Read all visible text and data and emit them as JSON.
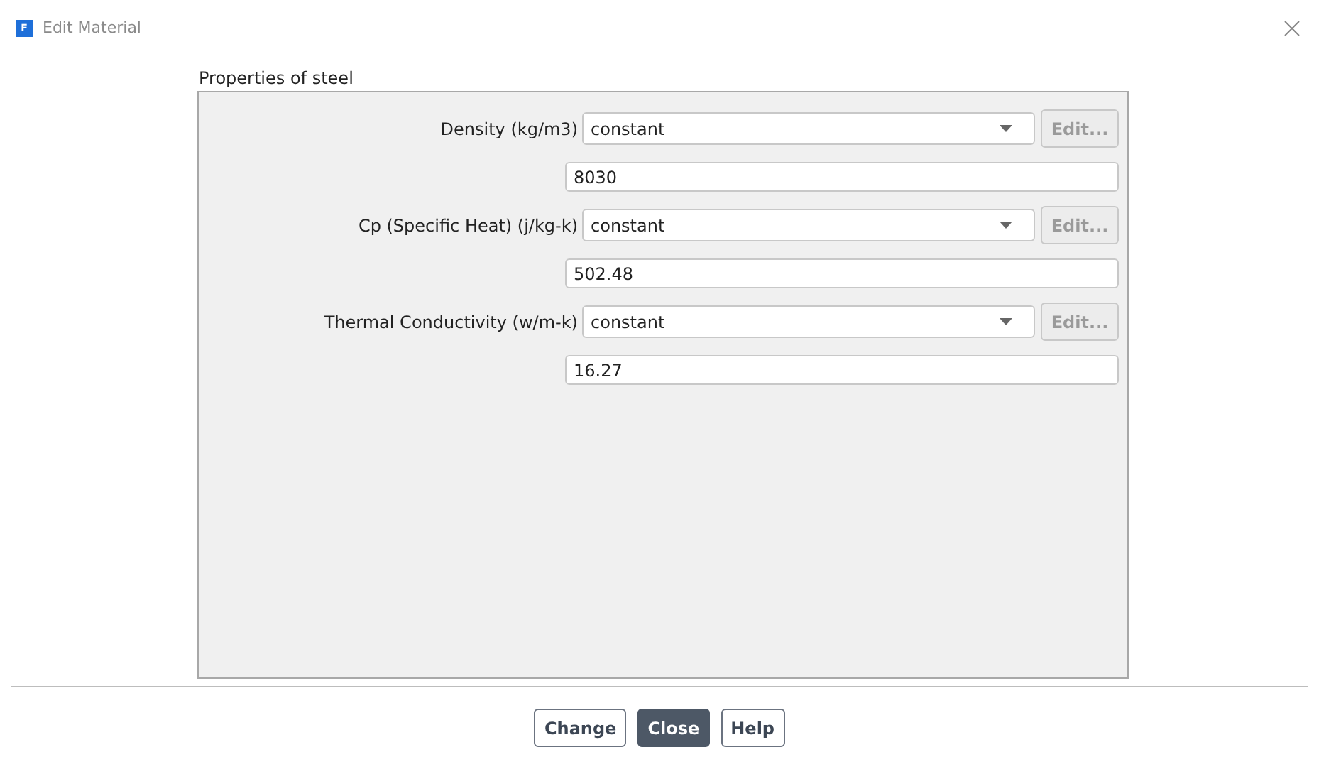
{
  "window": {
    "title": "Edit Material",
    "app_icon_letter": "F"
  },
  "group": {
    "title": "Properties of steel"
  },
  "properties": [
    {
      "label": "Density (kg/m3)",
      "method": "constant",
      "edit_button": {
        "label": "Edit...",
        "disabled": true
      },
      "value": "8030"
    },
    {
      "label": "Cp (Specific Heat) (j/kg-k)",
      "method": "constant",
      "edit_button": {
        "label": "Edit...",
        "disabled": true
      },
      "value": "502.48"
    },
    {
      "label": "Thermal Conductivity (w/m-k)",
      "method": "constant",
      "edit_button": {
        "label": "Edit...",
        "disabled": true
      },
      "value": "16.27"
    }
  ],
  "buttons": [
    {
      "label": "Change",
      "default": false
    },
    {
      "label": "Close",
      "default": true
    },
    {
      "label": "Help",
      "default": false
    }
  ]
}
